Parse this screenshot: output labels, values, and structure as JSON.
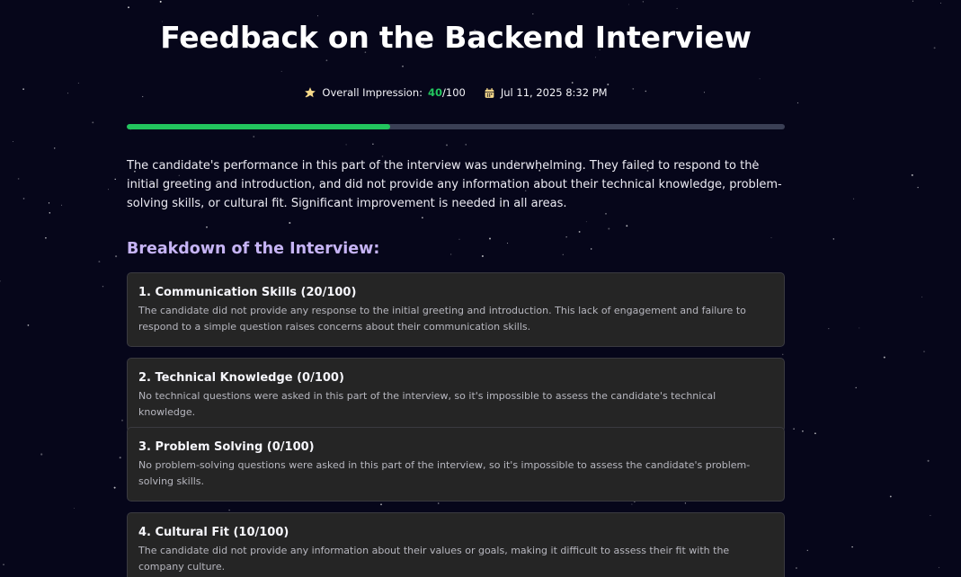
{
  "title": "Feedback on the Backend Interview",
  "meta": {
    "impression_label": "Overall Impression:",
    "impression_score": "40",
    "impression_total": "/100",
    "impression_fraction": 0.4,
    "date": "Jul 11, 2025 8:32 PM",
    "star_icon": "star-icon",
    "calendar_icon": "calendar-icon"
  },
  "summary": "The candidate's performance in this part of the interview was underwhelming. They failed to respond to the initial greeting and introduction, and did not provide any information about their technical knowledge, problem-solving skills, or cultural fit. Significant improvement is needed in all areas.",
  "breakdown": {
    "heading": "Breakdown of the Interview:",
    "items": [
      {
        "title": "1. Communication Skills (20/100)",
        "text": "The candidate did not provide any response to the initial greeting and introduction. This lack of engagement and failure to respond to a simple question raises concerns about their communication skills."
      },
      {
        "title": "2. Technical Knowledge (0/100)",
        "text": "No technical questions were asked in this part of the interview, so it's impossible to assess the candidate's technical knowledge."
      },
      {
        "title": "3. Problem Solving (0/100)",
        "text": "No problem-solving questions were asked in this part of the interview, so it's impossible to assess the candidate's problem-solving skills."
      },
      {
        "title": "4. Cultural Fit (10/100)",
        "text": "The candidate did not provide any information about their values or goals, making it difficult to assess their fit with the company culture."
      }
    ]
  },
  "colors": {
    "background": "#06061a",
    "accent_green": "#22c55e",
    "heading_purple": "#c6b4f5",
    "card_bg": "#252525"
  }
}
